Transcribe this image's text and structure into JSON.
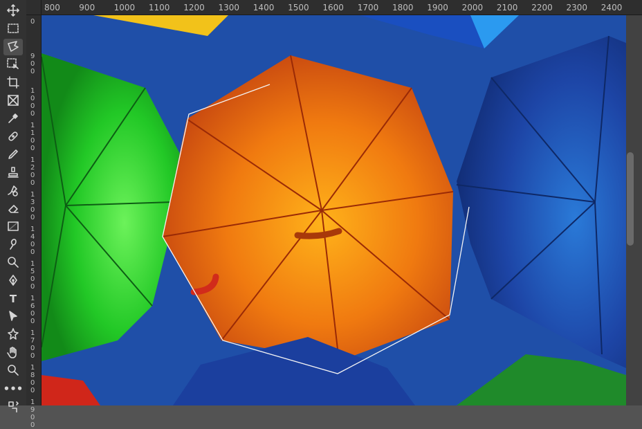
{
  "ruler": {
    "top_labels": [
      "800",
      "900",
      "1000",
      "1100",
      "1200",
      "1300",
      "1400",
      "1500",
      "1600",
      "1700",
      "1800",
      "1900",
      "2000",
      "2100",
      "2200",
      "2300",
      "2400"
    ],
    "left_labels": [
      "0",
      "9\n0\n0",
      "1\n0\n0\n0",
      "1\n1\n0\n0",
      "1\n2\n0\n0",
      "1\n3\n0\n0",
      "1\n4\n0\n0",
      "1\n5\n0\n0",
      "1\n6\n0\n0",
      "1\n7\n0\n0",
      "1\n8\n0\n0",
      "1\n9\n0\n0"
    ]
  },
  "tools": [
    {
      "name": "move-tool",
      "icon": "move-icon",
      "active": false
    },
    {
      "name": "rectangular-marquee-tool",
      "icon": "marquee-icon",
      "active": false
    },
    {
      "name": "polygonal-lasso-tool",
      "icon": "polygonal-lasso-icon",
      "active": true
    },
    {
      "name": "object-selection-tool",
      "icon": "object-selection-icon",
      "active": false
    },
    {
      "name": "crop-tool",
      "icon": "crop-icon",
      "active": false
    },
    {
      "name": "frame-tool",
      "icon": "frame-icon",
      "active": false
    },
    {
      "name": "eyedropper-tool",
      "icon": "eyedropper-icon",
      "active": false
    },
    {
      "name": "healing-brush-tool",
      "icon": "bandage-icon",
      "active": false
    },
    {
      "name": "brush-tool",
      "icon": "brush-icon",
      "active": false
    },
    {
      "name": "clone-stamp-tool",
      "icon": "stamp-icon",
      "active": false
    },
    {
      "name": "history-brush-tool",
      "icon": "history-brush-icon",
      "active": false
    },
    {
      "name": "eraser-tool",
      "icon": "eraser-icon",
      "active": false
    },
    {
      "name": "gradient-tool",
      "icon": "gradient-icon",
      "active": false
    },
    {
      "name": "smudge-tool",
      "icon": "smudge-icon",
      "active": false
    },
    {
      "name": "dodge-tool",
      "icon": "dodge-icon",
      "active": false
    },
    {
      "name": "pen-tool",
      "icon": "pen-icon",
      "active": false
    },
    {
      "name": "type-tool",
      "icon": "type-icon",
      "active": false,
      "label": "T"
    },
    {
      "name": "path-selection-tool",
      "icon": "path-selection-icon",
      "active": false
    },
    {
      "name": "custom-shape-tool",
      "icon": "shape-icon",
      "active": false
    },
    {
      "name": "hand-tool",
      "icon": "hand-icon",
      "active": false
    },
    {
      "name": "zoom-tool",
      "icon": "zoom-icon",
      "active": false
    },
    {
      "name": "more-tools",
      "icon": "more-icon",
      "active": false,
      "label": "•••"
    },
    {
      "name": "swap-colors",
      "icon": "swap-icon",
      "active": false
    }
  ],
  "colors": {
    "sky": "#1f4fa8",
    "orange": "#f07a10",
    "red": "#c8420f",
    "green": "#22c826",
    "blue": "#1f49b0",
    "yellow": "#f2c21a"
  }
}
